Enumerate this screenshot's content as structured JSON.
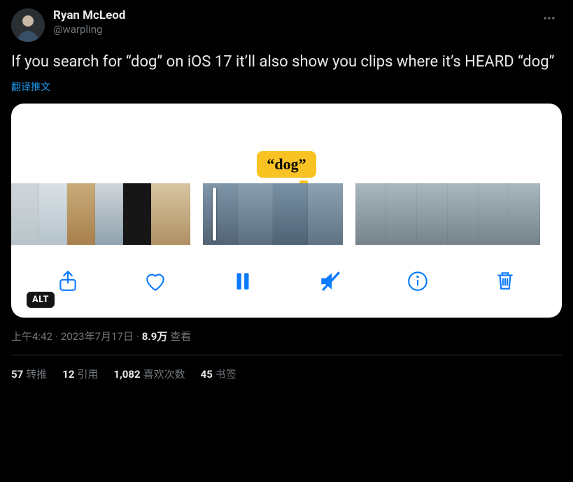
{
  "author": {
    "display_name": "Ryan McLeod",
    "handle": "@warpling"
  },
  "body": "If you search for “dog” on iOS 17 it’ll also show you clips where it’s HEARD “dog”",
  "translate_label": "翻译推文",
  "media": {
    "caption_label": "“dog”",
    "alt_badge": "ALT"
  },
  "meta": {
    "time": "上午4:42",
    "date": "2023年7月17日",
    "views_count": "8.9万",
    "views_label": "查看"
  },
  "engagement": {
    "retweets": {
      "count": "57",
      "label": "转推"
    },
    "quotes": {
      "count": "12",
      "label": "引用"
    },
    "likes": {
      "count": "1,082",
      "label": "喜欢次数"
    },
    "bookmarks": {
      "count": "45",
      "label": "书签"
    }
  }
}
